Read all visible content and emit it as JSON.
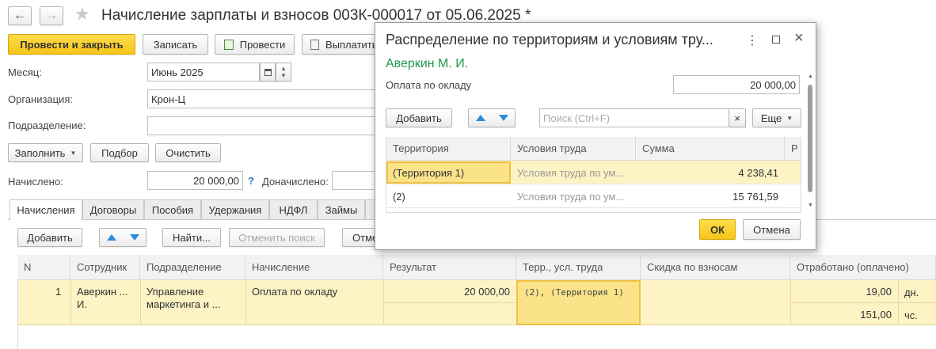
{
  "window": {
    "title": "Начисление зарплаты и взносов 003К-000017 от 05.06.2025 *"
  },
  "toolbar": {
    "post_close": "Провести и закрыть",
    "save": "Записать",
    "post": "Провести",
    "pay": "Выплатить"
  },
  "form": {
    "month_label": "Месяц:",
    "month_value": "Июнь 2025",
    "org_label": "Организация:",
    "org_value": "Крон-Ц",
    "dept_label": "Подразделение:",
    "dept_value": "",
    "fill_btn": "Заполнить",
    "pick_btn": "Подбор",
    "clear_btn": "Очистить",
    "accrued_label": "Начислено:",
    "accrued_value": "20 000,00",
    "accrued_help": "?",
    "extra_label": "Доначислено:"
  },
  "tabs": [
    "Начисления",
    "Договоры",
    "Пособия",
    "Удержания",
    "НДФЛ",
    "Займы"
  ],
  "table_toolbar": {
    "add": "Добавить",
    "find": "Найти...",
    "cancel_search": "Отменить поиск",
    "more": "Отме"
  },
  "table": {
    "headers": [
      "N",
      "Сотрудник",
      "Подразделение",
      "Начисление",
      "Результат",
      "Терр., усл. труда",
      "Скидка по взносам",
      "Отработано (оплачено)"
    ],
    "row": {
      "n": "1",
      "employee_1": "Аверкин ...",
      "employee_2": "И.",
      "dept_1": "Управление",
      "dept_2": "маркетинга и ...",
      "accrual": "Оплата по окладу",
      "result": "20 000,00",
      "territory": "(2), (Территория 1)",
      "discount": "",
      "worked_days": "19,00",
      "days_unit": "дн.",
      "worked_hours": "151,00",
      "hours_unit": "чс."
    }
  },
  "dialog": {
    "title": "Распределение по территориям и условиям тру...",
    "employee": "Аверкин М. И.",
    "accrual_label": "Оплата по окладу",
    "accrual_value": "20 000,00",
    "add": "Добавить",
    "search_placeholder": "Поиск (Ctrl+F)",
    "search_clear": "×",
    "more": "Еще",
    "headers": [
      "Территория",
      "Условия труда",
      "Сумма",
      "Р"
    ],
    "rows": [
      {
        "territory": "(Территория 1)",
        "conditions": "Условия труда по ум...",
        "amount": "4 238,41"
      },
      {
        "territory": "(2)",
        "conditions": "Условия труда по ум...",
        "amount": "15 761,59"
      }
    ],
    "ok": "ОК",
    "cancel": "Отмена"
  },
  "colors": {
    "accent_yellow": "#f5c518",
    "selection_row": "#fdf3c4",
    "selection_border": "#f0c040",
    "employee_green": "#1e9a4a",
    "arrow_blue": "#2e8bd8"
  }
}
